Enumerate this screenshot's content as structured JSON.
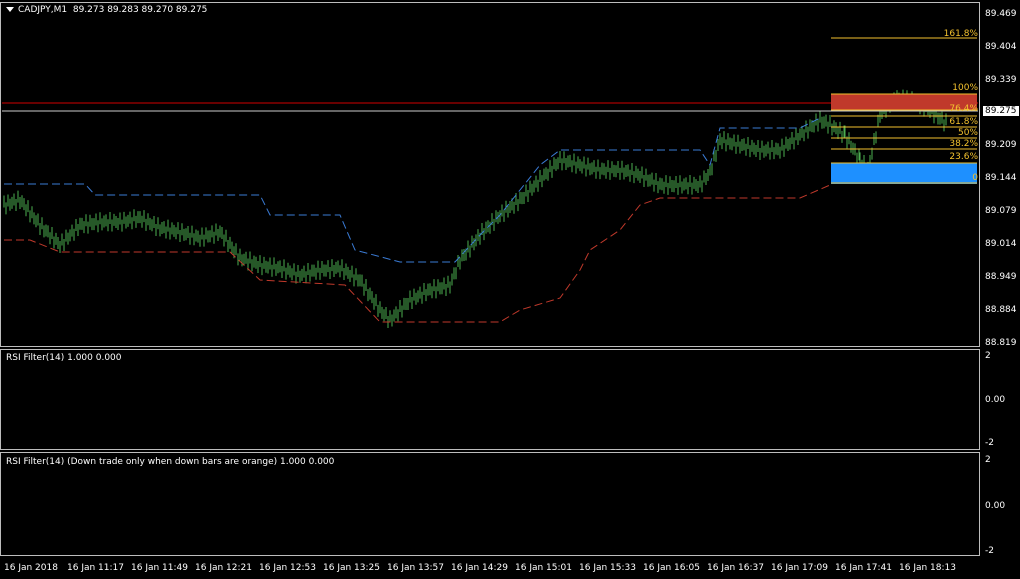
{
  "main": {
    "symbol_label": "CADJPY,M1",
    "ohlc": "89.273 89.283 89.270 89.275",
    "current_price": "89.275",
    "price_axis": [
      "89.469",
      "89.404",
      "89.339",
      "89.274",
      "89.209",
      "89.144",
      "89.079",
      "89.014",
      "88.949",
      "88.884",
      "88.819"
    ],
    "fib_levels": [
      "161.8%",
      "100%",
      "76.4%",
      "61.8%",
      "50%",
      "38.2%",
      "23.6%",
      "0"
    ]
  },
  "ind1": {
    "title": "RSI Filter(14) 1.000 0.000",
    "axis": [
      "2",
      "0.00",
      "-2"
    ]
  },
  "ind2": {
    "title": "RSI Filter(14)  (Down trade only when down bars are orange) 1.000 0.000",
    "axis": [
      "2",
      "0.00",
      "-2"
    ]
  },
  "time_axis": [
    "16 Jan 2018",
    "16 Jan 11:17",
    "16 Jan 11:49",
    "16 Jan 12:21",
    "16 Jan 12:53",
    "16 Jan 13:25",
    "16 Jan 13:57",
    "16 Jan 14:29",
    "16 Jan 15:01",
    "16 Jan 15:33",
    "16 Jan 16:05",
    "16 Jan 16:37",
    "16 Jan 17:09",
    "16 Jan 17:41",
    "16 Jan 18:13"
  ],
  "colors": {
    "up_bars": "#4caf50",
    "upper_band": "#3a7bd5",
    "lower_band": "#c0392b",
    "fib": "#f2c12e",
    "ind_up": "#00bfff",
    "ind_down": "#ff0000",
    "hist_up": "#c8c8c8",
    "hist_down": "#e8a890"
  }
}
